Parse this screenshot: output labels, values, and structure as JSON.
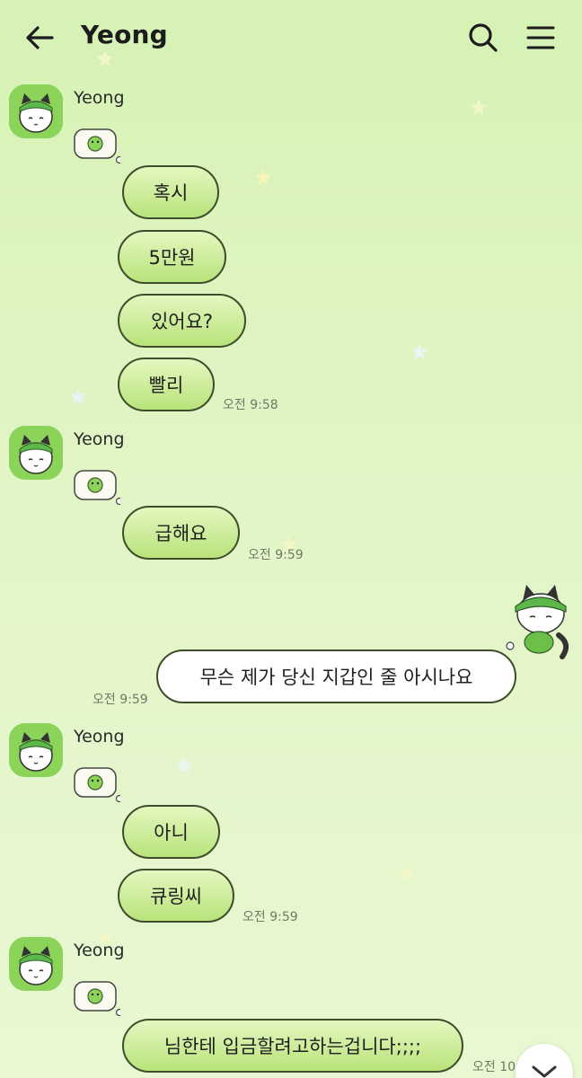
{
  "header": {
    "title": "Yeong",
    "back_icon": "arrow-left-icon",
    "search_icon": "search-icon",
    "menu_icon": "hamburger-menu-icon"
  },
  "colors": {
    "background_top": "#d6f2b4",
    "background_bottom": "#e8f8d2",
    "bubble_border": "#3f4d2c",
    "bubble_fill_top": "#e3f7c0",
    "bubble_fill_bottom": "#b9e37a",
    "my_bubble_fill": "#ffffff",
    "avatar_bg": "#8cd35a"
  },
  "messages": {
    "g1": {
      "sender": "Yeong",
      "m1": "혹시",
      "m2": "5만원",
      "m3": "있어요?",
      "m4": "빨리",
      "time": "오전 9:58"
    },
    "g2": {
      "sender": "Yeong",
      "m1": "급해요",
      "time": "오전 9:59"
    },
    "mine": {
      "m1": "무슨 제가 당신 지갑인 줄 아시나요",
      "time": "오전 9:59"
    },
    "g3": {
      "sender": "Yeong",
      "m1": "아니",
      "m2": "큐링씨",
      "time": "오전 9:59"
    },
    "g4": {
      "sender": "Yeong",
      "m1": "님한테 입금할려고하는겁니다;;;;",
      "time": "오전 10:"
    }
  },
  "scroll_down_icon": "chevron-down-icon"
}
